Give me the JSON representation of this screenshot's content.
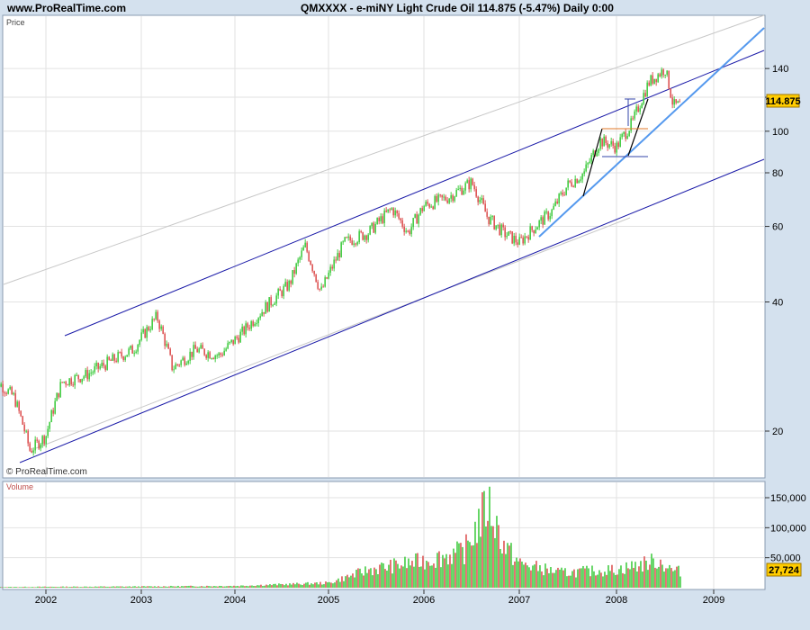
{
  "header": {
    "site": "www.ProRealTime.com",
    "title": "QMXXXX - e-miNY Light Crude Oil   114.875 (-5.47%)   Daily  0:00"
  },
  "price_panel": {
    "label": "Price",
    "watermark": "© ProRealTime.com",
    "last_value": "114.875"
  },
  "volume_panel": {
    "label": "Volume",
    "last_value": "27,724"
  },
  "colors": {
    "up": "#44cc44",
    "down": "#dd5555",
    "channel": "#1a1aa8",
    "trendline": "#5599ee",
    "badge": "#ffcc00",
    "background": "#d4e1ee"
  },
  "chart_data": [
    {
      "type": "candlestick",
      "title": "QMXXXX - e-miNY Light Crude Oil",
      "ylabel": "Price",
      "yscale": "log",
      "ylim": [
        16,
        160
      ],
      "x_tick_labels": [
        "2002",
        "2003",
        "2004",
        "2005",
        "2006",
        "2007",
        "2008",
        "2009"
      ],
      "y_tick_labels": [
        "20",
        "40",
        "60",
        "80",
        "100",
        "120",
        "140"
      ],
      "x": [
        "2001-06",
        "2001-09",
        "2001-11",
        "2002-01",
        "2002-03",
        "2002-06",
        "2002-09",
        "2002-12",
        "2003-03",
        "2003-05",
        "2003-08",
        "2003-11",
        "2004-02",
        "2004-05",
        "2004-08",
        "2004-10",
        "2004-12",
        "2005-03",
        "2005-06",
        "2005-09",
        "2005-11",
        "2006-01",
        "2006-04",
        "2006-07",
        "2006-09",
        "2006-11",
        "2007-01",
        "2007-03",
        "2007-05",
        "2007-07",
        "2007-09",
        "2007-11",
        "2008-01",
        "2008-03",
        "2008-05",
        "2008-07",
        "2008-08"
      ],
      "close": [
        27,
        24,
        18,
        19.5,
        26,
        27,
        29,
        31,
        37,
        28,
        31,
        30,
        34,
        39,
        44,
        54,
        42,
        55,
        58,
        66,
        58,
        67,
        70,
        76,
        63,
        58,
        55,
        60,
        65,
        75,
        80,
        95,
        92,
        105,
        130,
        140,
        114.875
      ],
      "last_value": 114.875
    },
    {
      "type": "bar",
      "title": "Volume",
      "ylim": [
        0,
        160000
      ],
      "y_tick_labels": [
        "50,000",
        "100,000",
        "150,000"
      ],
      "x": [
        "2001-06",
        "2002-01",
        "2003-01",
        "2004-01",
        "2005-01",
        "2005-06",
        "2006-01",
        "2006-06",
        "2006-09",
        "2006-11",
        "2007-01",
        "2007-06",
        "2008-01",
        "2008-06",
        "2008-08"
      ],
      "values": [
        1000,
        1500,
        2000,
        3000,
        8000,
        30000,
        45000,
        60000,
        140000,
        70000,
        40000,
        25000,
        30000,
        45000,
        27724
      ],
      "last_value": 27724
    }
  ]
}
